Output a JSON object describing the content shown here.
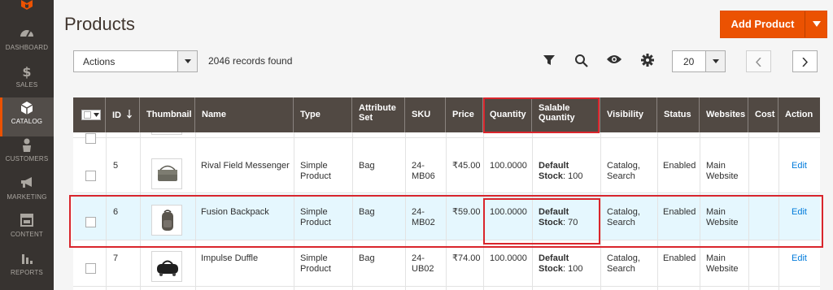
{
  "sidebar": {
    "items": [
      {
        "label": "DASHBOARD",
        "icon": "gauge-icon"
      },
      {
        "label": "SALES",
        "icon": "dollar-icon"
      },
      {
        "label": "CATALOG",
        "icon": "cube-icon",
        "active": true
      },
      {
        "label": "CUSTOMERS",
        "icon": "person-icon"
      },
      {
        "label": "MARKETING",
        "icon": "megaphone-icon"
      },
      {
        "label": "CONTENT",
        "icon": "layout-icon"
      },
      {
        "label": "REPORTS",
        "icon": "bar-chart-icon"
      }
    ]
  },
  "header": {
    "title": "Products",
    "add_product_label": "Add Product"
  },
  "toolbar": {
    "actions_value": "Actions",
    "records_found": "2046 records found",
    "per_page": "20"
  },
  "grid": {
    "columns": [
      "ID",
      "Thumbnail",
      "Name",
      "Type",
      "Attribute Set",
      "SKU",
      "Price",
      "Quantity",
      "Salable Quantity",
      "Visibility",
      "Status",
      "Websites",
      "Cost",
      "Action"
    ],
    "rows": [
      {
        "id": "5",
        "name": "Rival Field Messenger",
        "type": "Simple Product",
        "attribute_set": "Bag",
        "sku": "24-MB06",
        "price": "₹45.00",
        "quantity": "100.0000",
        "salable_label": "Default Stock",
        "salable_qty": "100",
        "visibility": "Catalog, Search",
        "status": "Enabled",
        "websites": "Main Website",
        "cost": "",
        "action": "Edit"
      },
      {
        "id": "6",
        "name": "Fusion Backpack",
        "type": "Simple Product",
        "attribute_set": "Bag",
        "sku": "24-MB02",
        "price": "₹59.00",
        "quantity": "100.0000",
        "salable_label": "Default Stock",
        "salable_qty": "70",
        "visibility": "Catalog, Search",
        "status": "Enabled",
        "websites": "Main Website",
        "cost": "",
        "action": "Edit"
      },
      {
        "id": "7",
        "name": "Impulse Duffle",
        "type": "Simple Product",
        "attribute_set": "Bag",
        "sku": "24-UB02",
        "price": "₹74.00",
        "quantity": "100.0000",
        "salable_label": "Default Stock",
        "salable_qty": "100",
        "visibility": "Catalog, Search",
        "status": "Enabled",
        "websites": "Main Website",
        "cost": "",
        "action": "Edit"
      }
    ]
  },
  "colors": {
    "accent": "#eb5202",
    "sidebar": "#373330",
    "header": "#514943",
    "highlight": "#e5f7fe",
    "annotation": "#d9252c",
    "link": "#007bdb"
  }
}
